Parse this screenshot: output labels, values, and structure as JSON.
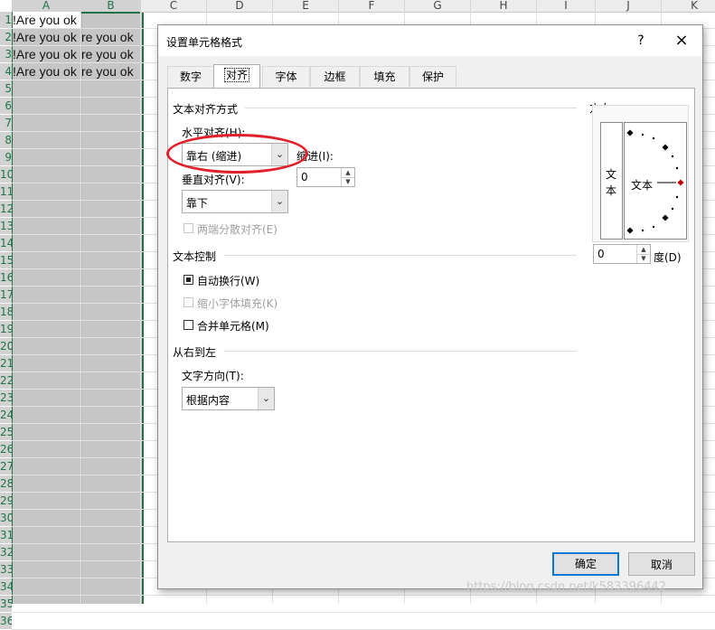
{
  "spreadsheet": {
    "columns": [
      "A",
      "B",
      "C",
      "D",
      "E",
      "F",
      "G",
      "H",
      "I",
      "J",
      "K"
    ],
    "rows": [
      "1",
      "2",
      "3",
      "4",
      "5",
      "6",
      "7",
      "8",
      "9",
      "10",
      "11",
      "12",
      "13",
      "14",
      "15",
      "16",
      "17",
      "18",
      "19",
      "20",
      "21",
      "22",
      "23",
      "24",
      "25",
      "26",
      "27",
      "28",
      "29",
      "30",
      "31",
      "32",
      "33",
      "34",
      "35",
      "36"
    ],
    "cells": {
      "a1": "!Are you ok",
      "a2": "!Are you ok",
      "b2": "re you ok",
      "a3": "!Are you ok",
      "b3": "re you ok",
      "a4": "!Are you ok",
      "b4": "re you ok"
    }
  },
  "dialog": {
    "title": "设置单元格格式",
    "help_label": "?",
    "close_label": "×",
    "tabs": [
      "数字",
      "对齐",
      "字体",
      "边框",
      "填充",
      "保护"
    ],
    "active_tab": "对齐",
    "text_alignment": {
      "group_label": "文本对齐方式",
      "horizontal_label": "水平对齐(H):",
      "horizontal_value": "靠右 (缩进)",
      "indent_label": "缩进(I):",
      "indent_value": "0",
      "vertical_label": "垂直对齐(V):",
      "vertical_value": "靠下",
      "justify_distributed_label": "两端分散对齐(E)"
    },
    "text_control": {
      "group_label": "文本控制",
      "wrap_text_label": "自动换行(W)",
      "wrap_text_checked": true,
      "shrink_to_fit_label": "缩小字体填充(K)",
      "shrink_to_fit_checked": false,
      "merge_cells_label": "合并单元格(M)",
      "merge_cells_checked": false
    },
    "rtl": {
      "group_label": "从右到左",
      "direction_label": "文字方向(T):",
      "direction_value": "根据内容"
    },
    "orientation": {
      "group_label": "方向",
      "vertical_text_chars": [
        "文",
        "本"
      ],
      "dial_text": "文本",
      "degrees_value": "0",
      "degrees_label": "度(D)"
    },
    "ok_label": "确定",
    "cancel_label": "取消"
  },
  "watermark": "https://blog.csdn.net/k583396442",
  "colors": {
    "excel_green": "#217346",
    "annotation_red": "#e0202a",
    "default_button_border": "#0078d7"
  }
}
